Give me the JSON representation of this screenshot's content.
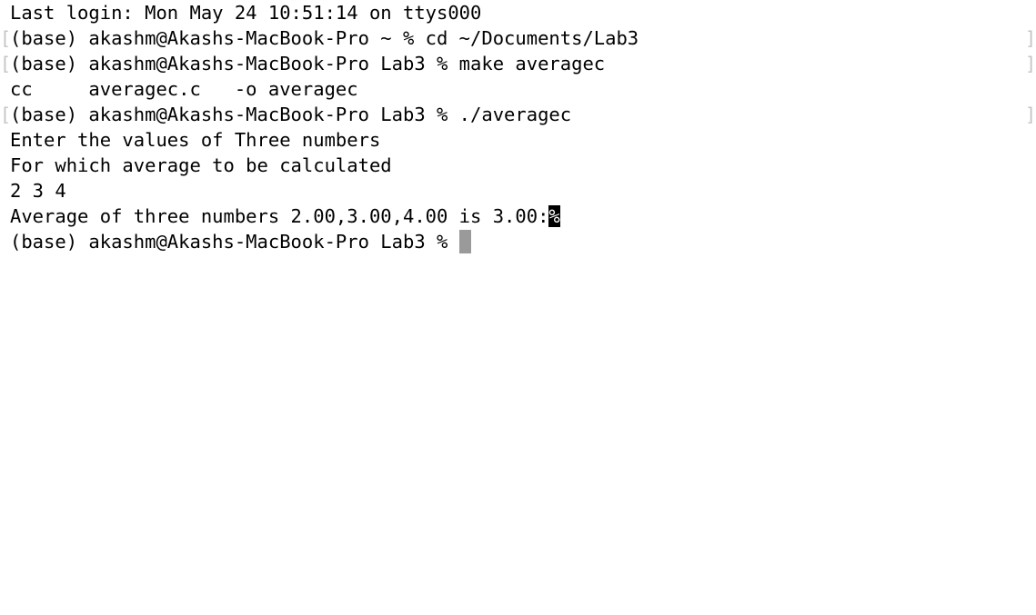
{
  "terminal": {
    "last_login": "Last login: Mon May 24 10:51:14 on ttys000",
    "cmd_cd": "(base) akashm@Akashs-MacBook-Pro ~ % cd ~/Documents/Lab3",
    "cmd_make": "(base) akashm@Akashs-MacBook-Pro Lab3 % make averagec",
    "make_output": "cc     averagec.c   -o averagec",
    "cmd_run": "(base) akashm@Akashs-MacBook-Pro Lab3 % ./averagec",
    "prompt_line_1": "Enter the values of Three numbers",
    "prompt_line_2": "For which average to be calculated",
    "user_input": "2 3 4",
    "result_text": "Average of three numbers 2.00,3.00,4.00 is 3.00:",
    "eol_marker": "%",
    "final_prompt": "(base) akashm@Akashs-MacBook-Pro Lab3 % ",
    "mark_left": "[",
    "mark_right": "]"
  }
}
